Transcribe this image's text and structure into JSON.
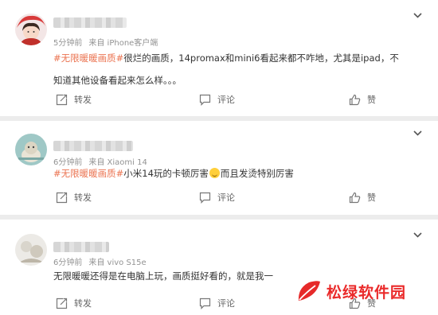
{
  "posts": [
    {
      "time": "5分钟前",
      "source": "来自 iPhone客户端",
      "topic": "#无限暖暖画质#",
      "text": "很烂的画质，14promax和mini6看起来都不咋地，尤其是ipad，不知道其他设备看起来怎么样。。。",
      "forward": "转发",
      "comment": "评论",
      "like": "赞"
    },
    {
      "time": "6分钟前",
      "source": "来自 Xiaomi 14",
      "topic": "#无限暖暖画质#",
      "text_before_emoji": "小米14玩的卡顿厉害",
      "text_after_emoji": "而且发烫特别厉害",
      "forward": "转发",
      "comment": "评论",
      "like": "赞"
    },
    {
      "time": "6分钟前",
      "source": "来自 vivo S15e",
      "text": "无限暖暖还得是在电脑上玩，画质挺好看的，就是我一",
      "forward": "转发",
      "comment": "评论",
      "like": "赞"
    }
  ],
  "watermark": "松绿软件园",
  "colors": {
    "topic": "#eb7350",
    "meta": "#939393",
    "watermark": "#ea2a2a"
  },
  "icons": [
    "chevron-down-icon",
    "forward-icon",
    "comment-icon",
    "like-icon"
  ]
}
